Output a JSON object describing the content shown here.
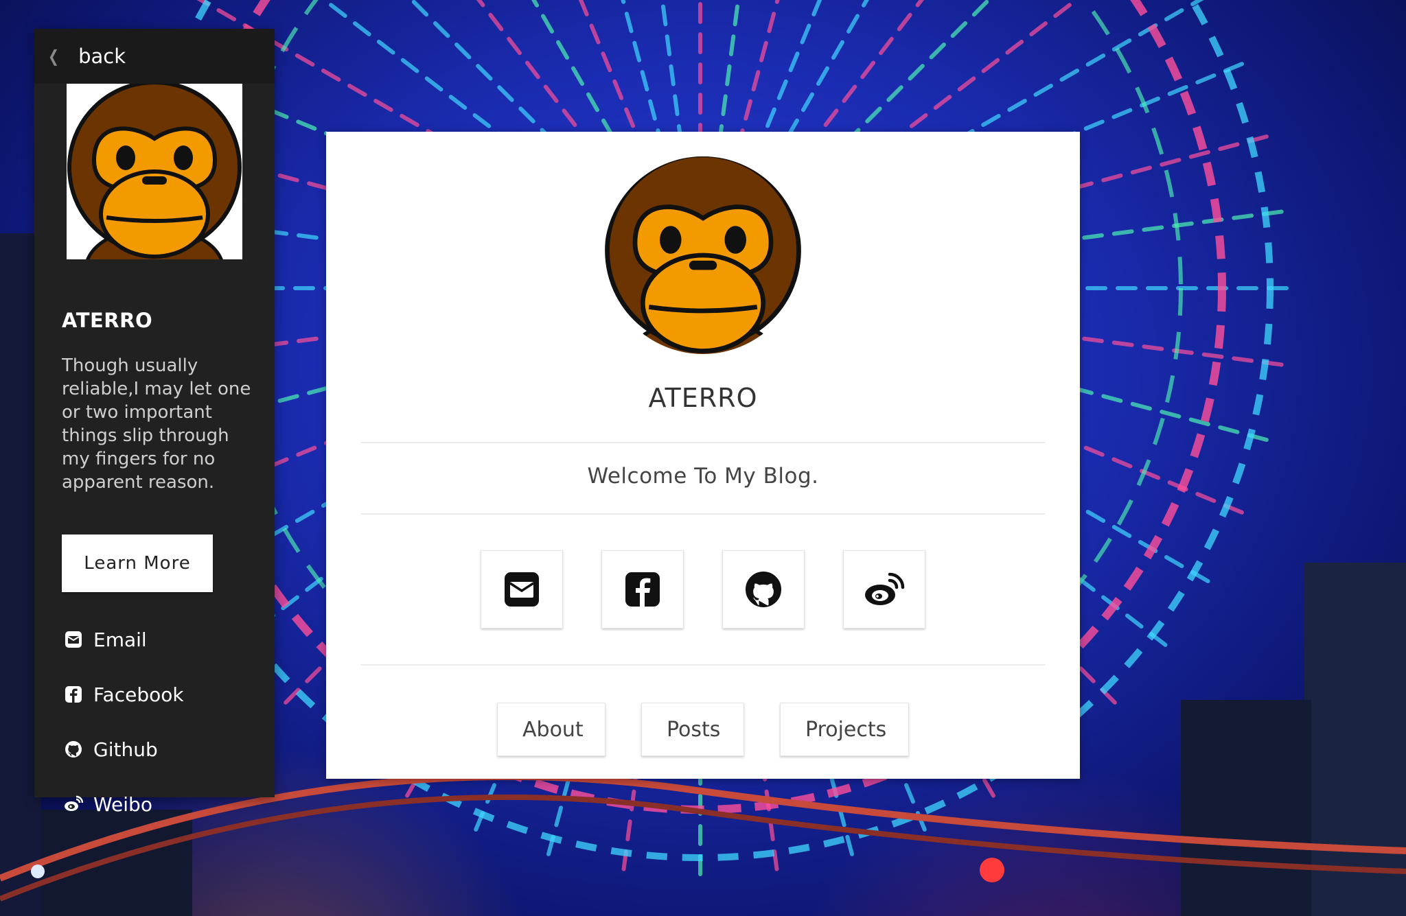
{
  "sidebar": {
    "back_label": "back",
    "name": "ATERRO",
    "description": "Though usually reliable,I may let one or two important things slip through my fingers for no apparent reason.",
    "learn_more_label": "Learn More",
    "links": [
      {
        "label": "Email",
        "icon": "envelope-icon"
      },
      {
        "label": "Facebook",
        "icon": "facebook-icon"
      },
      {
        "label": "Github",
        "icon": "github-icon"
      },
      {
        "label": "Weibo",
        "icon": "weibo-icon"
      }
    ]
  },
  "card": {
    "name": "ATERRO",
    "welcome": "Welcome To My Blog.",
    "social": [
      {
        "icon": "envelope-icon"
      },
      {
        "icon": "facebook-icon"
      },
      {
        "icon": "github-icon"
      },
      {
        "icon": "weibo-icon"
      }
    ],
    "nav": [
      {
        "label": "About"
      },
      {
        "label": "Posts"
      },
      {
        "label": "Projects"
      }
    ]
  },
  "colors": {
    "sidebar_bg": "#212121",
    "sidebar_top_bg": "#1a1a1a",
    "card_bg": "#ffffff",
    "avatar_fur": "#6b3400",
    "avatar_face": "#f39a00"
  }
}
